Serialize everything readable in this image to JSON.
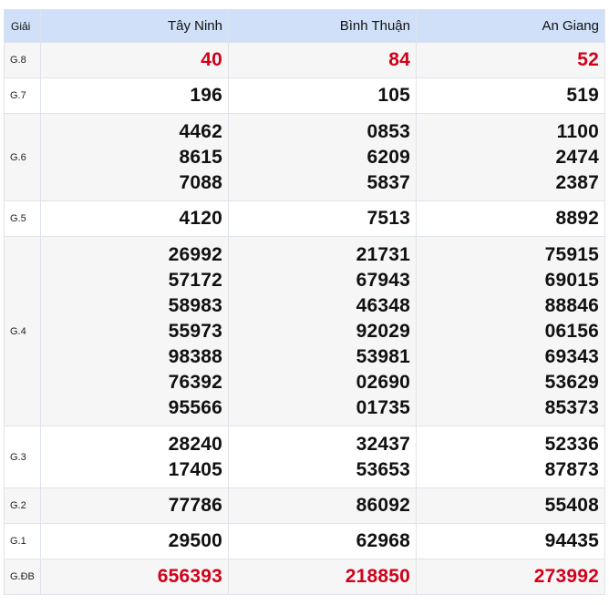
{
  "header": {
    "prize_label": "Giải",
    "provinces": [
      "Tây Ninh",
      "Bình Thuận",
      "An Giang"
    ]
  },
  "colors": {
    "header_bg": "#cfe0f8",
    "highlight_red": "#d0021b",
    "alt_row_bg": "#f6f6f6"
  },
  "rows": [
    {
      "prize": "G.8",
      "red": true,
      "values": [
        [
          "40"
        ],
        [
          "84"
        ],
        [
          "52"
        ]
      ]
    },
    {
      "prize": "G.7",
      "red": false,
      "values": [
        [
          "196"
        ],
        [
          "105"
        ],
        [
          "519"
        ]
      ]
    },
    {
      "prize": "G.6",
      "red": false,
      "values": [
        [
          "4462",
          "8615",
          "7088"
        ],
        [
          "0853",
          "6209",
          "5837"
        ],
        [
          "1100",
          "2474",
          "2387"
        ]
      ]
    },
    {
      "prize": "G.5",
      "red": false,
      "values": [
        [
          "4120"
        ],
        [
          "7513"
        ],
        [
          "8892"
        ]
      ]
    },
    {
      "prize": "G.4",
      "red": false,
      "values": [
        [
          "26992",
          "57172",
          "58983",
          "55973",
          "98388",
          "76392",
          "95566"
        ],
        [
          "21731",
          "67943",
          "46348",
          "92029",
          "53981",
          "02690",
          "01735"
        ],
        [
          "75915",
          "69015",
          "88846",
          "06156",
          "69343",
          "53629",
          "85373"
        ]
      ]
    },
    {
      "prize": "G.3",
      "red": false,
      "values": [
        [
          "28240",
          "17405"
        ],
        [
          "32437",
          "53653"
        ],
        [
          "52336",
          "87873"
        ]
      ]
    },
    {
      "prize": "G.2",
      "red": false,
      "values": [
        [
          "77786"
        ],
        [
          "86092"
        ],
        [
          "55408"
        ]
      ]
    },
    {
      "prize": "G.1",
      "red": false,
      "values": [
        [
          "29500"
        ],
        [
          "62968"
        ],
        [
          "94435"
        ]
      ]
    },
    {
      "prize": "G.ĐB",
      "red": true,
      "values": [
        [
          "656393"
        ],
        [
          "218850"
        ],
        [
          "273992"
        ]
      ]
    }
  ]
}
